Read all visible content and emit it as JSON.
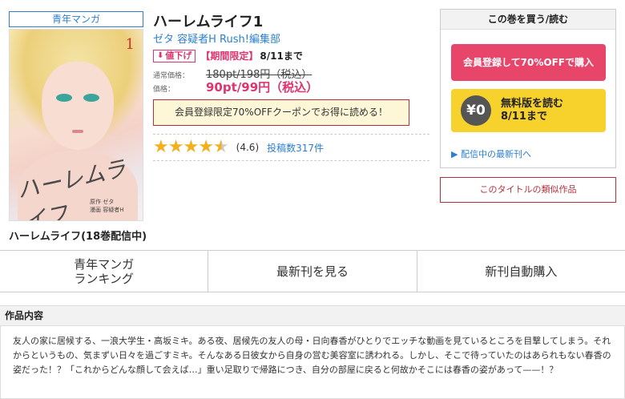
{
  "book": {
    "genre_tag": "青年マンガ",
    "cover_number": "1",
    "cover_logo": "ハーレムライフ",
    "cover_credits": [
      "原作 ゼタ",
      "漫画 容疑者H"
    ],
    "series_name": "ハーレムライフ(18巻配信中)",
    "title": "ハーレムライフ1",
    "authors": "ゼタ 容疑者H Rush!編集部",
    "sale_badge": "値下げ",
    "limited_label": "【期間限定】",
    "limited_date": "8/11まで",
    "regular_price_label": "通常価格：",
    "regular_price": "180pt/198円（税込）",
    "sale_price_label": "価格：",
    "sale_price": "90pt/99円（税込）",
    "coupon_text": "会員登録限定70%OFFクーポンでお得に読める！",
    "rating": "(4.6)",
    "rating_value": 4.6,
    "review_count": "投稿数317件"
  },
  "buybox": {
    "header": "この巻を買う/読む",
    "member_button": "会員登録して70%OFFで購入",
    "free_icon": "¥0",
    "free_line1": "無料版を読む",
    "free_line2": "8/11まで",
    "latest_link": "▶ 配信中の最新刊へ"
  },
  "similar_button": "このタイトルの類似作品",
  "nav": {
    "ranking_line1": "青年マンガ",
    "ranking_line2": "ランキング",
    "latest": "最新刊を見る",
    "auto_buy": "新刊自動購入"
  },
  "content": {
    "header": "作品内容",
    "synopsis": "友人の家に居候する、一浪大学生・高坂ミキ。ある夜、居候先の友人の母・日向春香がひとりでエッチな動画を見ているところを目撃してしまう。それからというもの、気まずい日々を過ごすミキ。そんなある日彼女から自身の営む美容室に誘われる。しかし、そこで待っていたのはあられもない春香の姿だった！？「これからどんな顔して会えば…」重い足取りで帰路につき、自分の部屋に戻ると何故かそこには春香の姿があって——！？"
  },
  "colors": {
    "accent_pink": "#e8456a",
    "link_blue": "#2b7fd0",
    "coupon_border": "#b52f3a",
    "free_yellow": "#f7d12c",
    "star_gold": "#f2b01e"
  }
}
